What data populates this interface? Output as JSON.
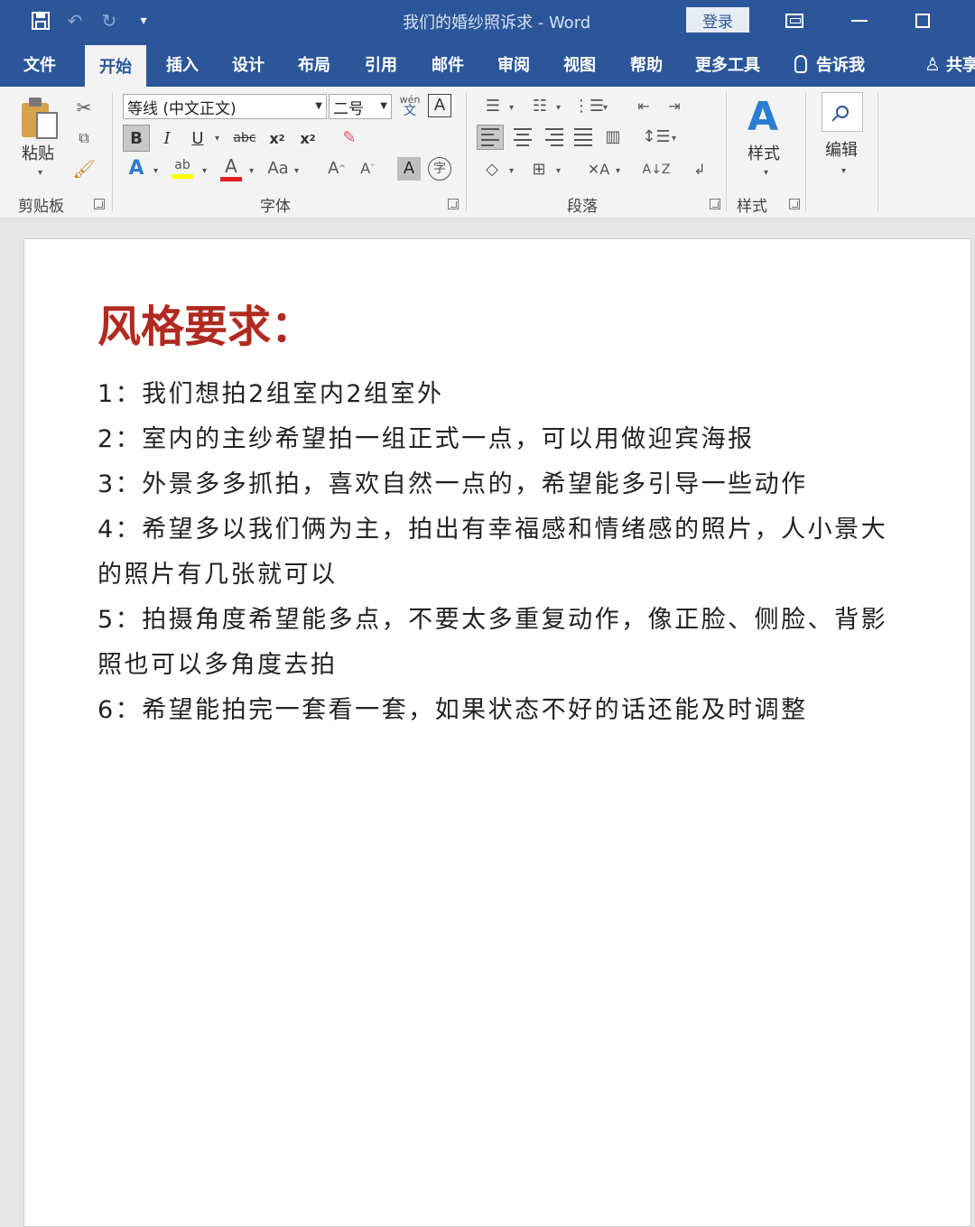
{
  "titlebar": {
    "title": "我们的婚纱照诉求  -  Word",
    "login": "登录"
  },
  "tabs": [
    "文件",
    "开始",
    "插入",
    "设计",
    "布局",
    "引用",
    "邮件",
    "审阅",
    "视图",
    "帮助",
    "更多工具"
  ],
  "active_tab": "开始",
  "tellme": "告诉我",
  "share": "共享",
  "ribbon": {
    "clipboard": {
      "paste": "粘贴",
      "label": "剪贴板"
    },
    "font": {
      "name": "等线 (中文正文)",
      "size": "二号",
      "label": "字体"
    },
    "paragraph": {
      "label": "段落"
    },
    "styles": {
      "button": "样式",
      "label": "样式"
    },
    "editing": {
      "button": "编辑"
    }
  },
  "document": {
    "heading": "风格要求：",
    "lines": [
      "1：我们想拍2组室内2组室外",
      "2：室内的主纱希望拍一组正式一点，可以用做迎宾海报",
      "3：外景多多抓拍，喜欢自然一点的，希望能多引导一些动作",
      "4：希望多以我们俩为主，拍出有幸福感和情绪感的照片，人小景大",
      "的照片有几张就可以",
      "5：拍摄角度希望能多点，不要太多重复动作，像正脸、侧脸、背影",
      "照也可以多角度去拍",
      "6：希望能拍完一套看一套，如果状态不好的话还能及时调整"
    ]
  }
}
